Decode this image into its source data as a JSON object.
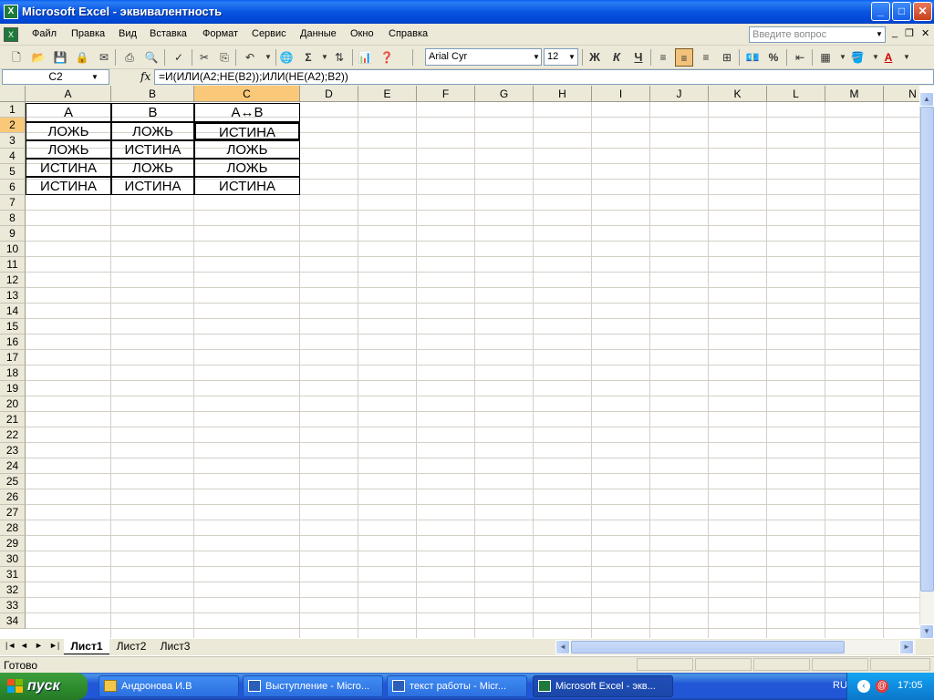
{
  "window": {
    "title": "Microsoft Excel - эквивалентность",
    "icon": "excel-icon",
    "controls": {
      "minimize": "_",
      "maximize": "□",
      "close": "✕"
    }
  },
  "menu": {
    "items": [
      "Файл",
      "Правка",
      "Вид",
      "Вставка",
      "Формат",
      "Сервис",
      "Данные",
      "Окно",
      "Справка"
    ],
    "help_placeholder": "Введите вопрос",
    "mdi_minimize": "_",
    "mdi_restore": "❐",
    "mdi_close": "✕"
  },
  "toolbar": {
    "font": "Arial Cyr",
    "size": "12",
    "bold": "Ж",
    "italic": "К",
    "underline": "Ч",
    "sum": "Σ",
    "percent": "%",
    "font_color_label": "A"
  },
  "formula_bar": {
    "name_box": "C2",
    "fx": "fx",
    "formula": "=И(ИЛИ(A2;НЕ(B2));ИЛИ(НЕ(A2);B2))"
  },
  "grid": {
    "columns": [
      "A",
      "B",
      "C",
      "D",
      "E",
      "F",
      "G",
      "H",
      "I",
      "J",
      "K",
      "L",
      "M",
      "N"
    ],
    "selected_column": "C",
    "selected_row": 2,
    "rows": [
      "1",
      "2",
      "3",
      "4",
      "5",
      "6",
      "7",
      "8",
      "9",
      "10",
      "11",
      "12",
      "13",
      "14",
      "15",
      "16",
      "17",
      "18",
      "19",
      "20",
      "21",
      "22",
      "23",
      "24",
      "25",
      "26",
      "27",
      "28",
      "29",
      "30",
      "31",
      "32",
      "33",
      "34"
    ],
    "table": {
      "header": [
        "A",
        "B",
        "A↔B"
      ],
      "data": [
        [
          "ЛОЖЬ",
          "ЛОЖЬ",
          "ИСТИНА"
        ],
        [
          "ЛОЖЬ",
          "ИСТИНА",
          "ЛОЖЬ"
        ],
        [
          "ИСТИНА",
          "ЛОЖЬ",
          "ЛОЖЬ"
        ],
        [
          "ИСТИНА",
          "ИСТИНА",
          "ИСТИНА"
        ]
      ]
    }
  },
  "sheets": {
    "nav": [
      "|◄",
      "◄",
      "►",
      "►|"
    ],
    "tabs": [
      "Лист1",
      "Лист2",
      "Лист3"
    ],
    "active": "Лист1"
  },
  "status": {
    "text": "Готово"
  },
  "taskbar": {
    "start": "пуск",
    "buttons": [
      "Андронова И.В",
      "Выступление - Micro...",
      "текст работы - Micr...",
      "Microsoft Excel - экв..."
    ],
    "active_index": 3,
    "lang": "RU",
    "clock": "17:05"
  }
}
